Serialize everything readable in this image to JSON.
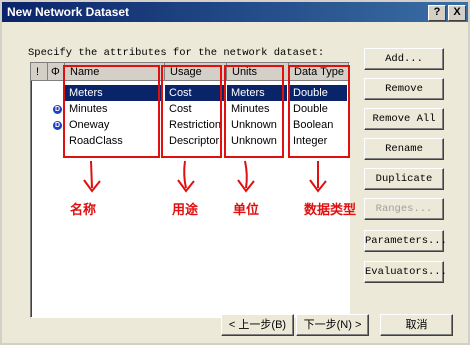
{
  "window": {
    "title": "New Network Dataset",
    "help_label": "?",
    "close_label": "X"
  },
  "prompt": "Specify the attributes for the network dataset:",
  "columns": {
    "flag": "!",
    "icon": "Φ",
    "name": "Name",
    "usage": "Usage",
    "units": "Units",
    "data_type": "Data Type"
  },
  "rows": [
    {
      "name": "Meters",
      "usage": "Cost",
      "units": "Meters",
      "data_type": "Double",
      "icon": ""
    },
    {
      "name": "Minutes",
      "usage": "Cost",
      "units": "Minutes",
      "data_type": "Double",
      "icon": "D"
    },
    {
      "name": "Oneway",
      "usage": "Restriction",
      "units": "Unknown",
      "data_type": "Boolean",
      "icon": "D"
    },
    {
      "name": "RoadClass",
      "usage": "Descriptor",
      "units": "Unknown",
      "data_type": "Integer",
      "icon": ""
    }
  ],
  "annotations": {
    "name": "名称",
    "usage": "用途",
    "units": "单位",
    "data_type": "数据类型"
  },
  "side_buttons": {
    "add": "Add...",
    "remove": "Remove",
    "remove_all": "Remove All",
    "rename": "Rename",
    "duplicate": "Duplicate",
    "ranges": "Ranges...",
    "parameters": "Parameters...",
    "evaluators": "Evaluators..."
  },
  "footer": {
    "back": "< 上一步(B)",
    "next": "下一步(N) >",
    "cancel": "取消"
  },
  "colors": {
    "annotation": "#e01010",
    "selection": "#0a246a",
    "title_bar": "#0a246a"
  }
}
